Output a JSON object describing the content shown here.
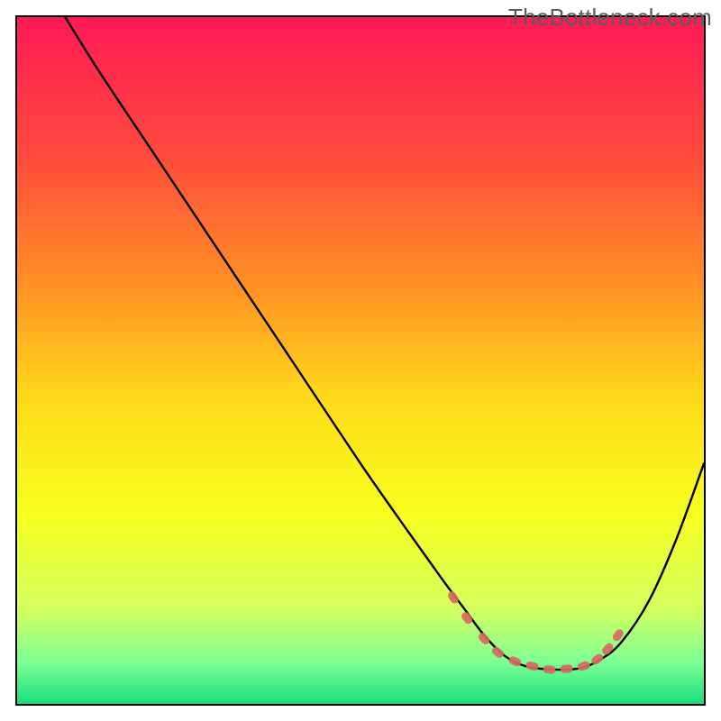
{
  "watermark": "TheBottleneck.com",
  "chart_data": {
    "type": "line",
    "title": "",
    "xlabel": "",
    "ylabel": "",
    "xlim": [
      0,
      100
    ],
    "ylim": [
      0,
      100
    ],
    "background_gradient": {
      "direction": "vertical",
      "stops": [
        {
          "pos": 0.0,
          "color": "#ff1a55"
        },
        {
          "pos": 0.2,
          "color": "#ff4a3d"
        },
        {
          "pos": 0.4,
          "color": "#ff9423"
        },
        {
          "pos": 0.55,
          "color": "#ffd91a"
        },
        {
          "pos": 0.72,
          "color": "#f7ff1e"
        },
        {
          "pos": 0.86,
          "color": "#d6ff5e"
        },
        {
          "pos": 0.94,
          "color": "#7cff94"
        },
        {
          "pos": 1.0,
          "color": "#17e07c"
        }
      ]
    },
    "curve": {
      "description": "Bottleneck-style V curve; steep descent from top-left, minimum basin around x≈70–85, rise toward right edge",
      "points_xy_pct": [
        [
          7,
          0
        ],
        [
          12,
          8
        ],
        [
          20,
          20
        ],
        [
          30,
          35
        ],
        [
          40,
          50
        ],
        [
          50,
          65
        ],
        [
          57,
          75
        ],
        [
          62,
          82
        ],
        [
          65,
          86
        ],
        [
          68,
          90
        ],
        [
          71,
          93
        ],
        [
          74,
          94.5
        ],
        [
          78,
          95
        ],
        [
          82,
          94.8
        ],
        [
          85,
          93.5
        ],
        [
          88,
          91
        ],
        [
          92,
          85
        ],
        [
          96,
          76
        ],
        [
          100,
          65
        ]
      ]
    },
    "markers": {
      "description": "Small coral capsule/ellipse markers along the basin of the curve",
      "color": "#d66a62",
      "points_xy_pct": [
        [
          63.5,
          84.5
        ],
        [
          65.5,
          87.5
        ],
        [
          68.0,
          90.5
        ],
        [
          70.0,
          92.5
        ],
        [
          72.5,
          93.8
        ],
        [
          75.0,
          94.5
        ],
        [
          77.5,
          95.0
        ],
        [
          80.0,
          94.9
        ],
        [
          82.5,
          94.5
        ],
        [
          84.5,
          93.5
        ],
        [
          86.0,
          92.0
        ],
        [
          87.5,
          90.0
        ]
      ]
    }
  }
}
